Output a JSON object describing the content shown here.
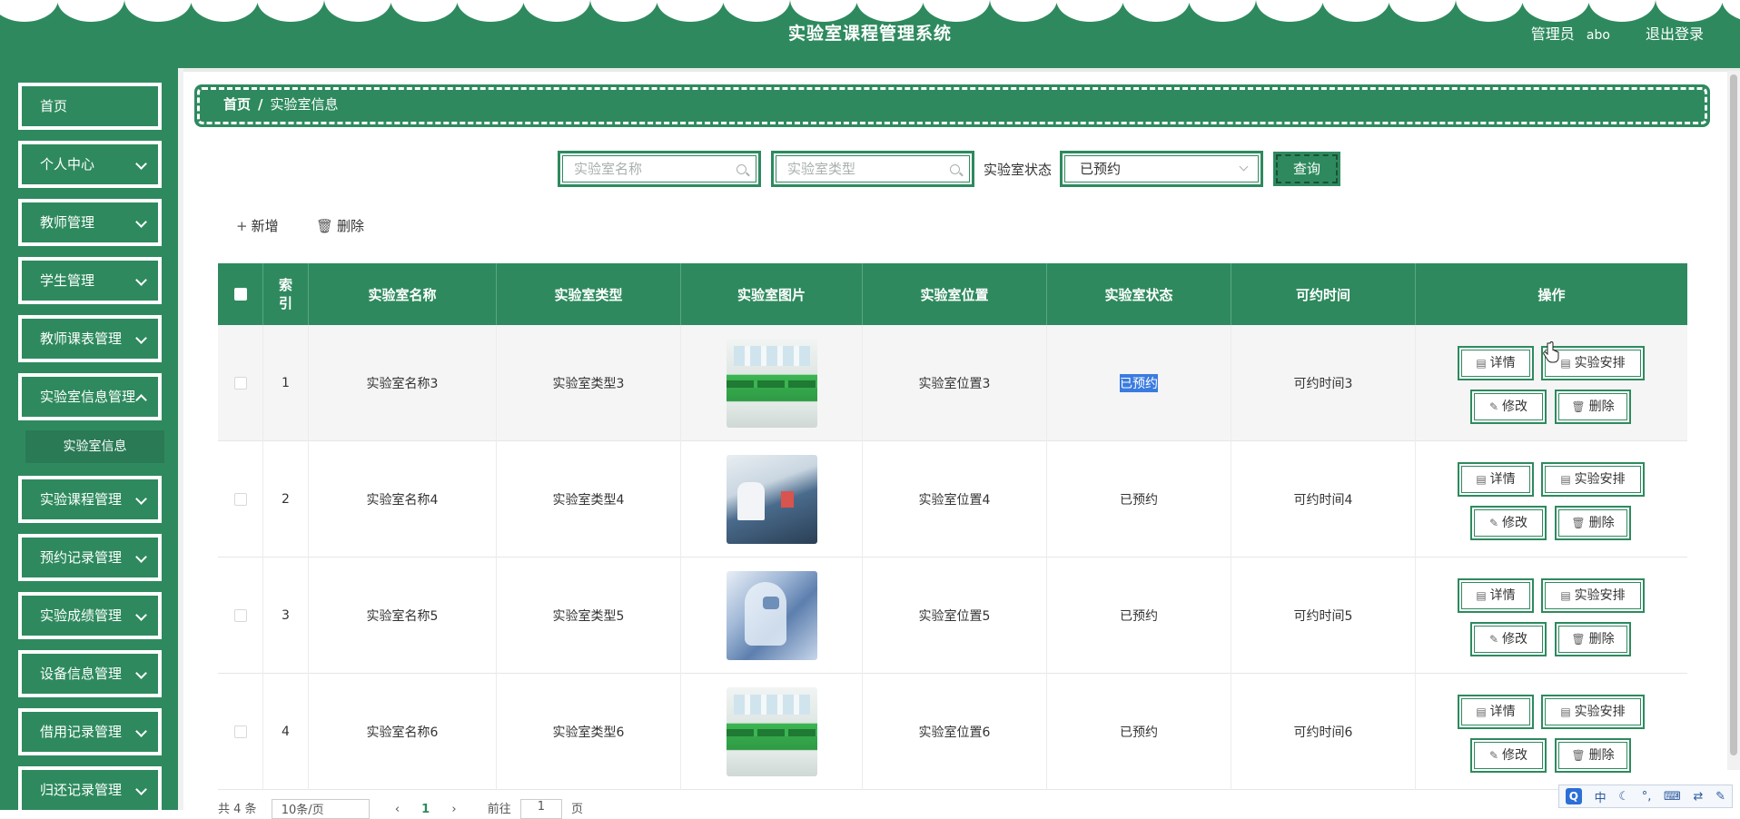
{
  "header": {
    "title": "实验室课程管理系统",
    "role": "管理员",
    "username": "abo",
    "logout": "退出登录"
  },
  "sidebar": {
    "items": [
      {
        "label": "首页",
        "expandable": false
      },
      {
        "label": "个人中心",
        "expandable": true
      },
      {
        "label": "教师管理",
        "expandable": true
      },
      {
        "label": "学生管理",
        "expandable": true
      },
      {
        "label": "教师课表管理",
        "expandable": true
      },
      {
        "label": "实验室信息管理",
        "expandable": true
      },
      {
        "label": "实验课程管理",
        "expandable": true
      },
      {
        "label": "预约记录管理",
        "expandable": true
      },
      {
        "label": "实验成绩管理",
        "expandable": true
      },
      {
        "label": "设备信息管理",
        "expandable": true
      },
      {
        "label": "借用记录管理",
        "expandable": true
      },
      {
        "label": "归还记录管理",
        "expandable": true
      }
    ],
    "active_submenu": "实验室信息"
  },
  "breadcrumb": {
    "home": "首页",
    "separator": "/",
    "current": "实验室信息"
  },
  "search": {
    "name_placeholder": "实验室名称",
    "type_placeholder": "实验室类型",
    "status_label": "实验室状态",
    "status_value": "已预约",
    "query_button": "查询"
  },
  "toolbar": {
    "add_label": "新增",
    "delete_label": "删除"
  },
  "table": {
    "columns": [
      "索引",
      "实验室名称",
      "实验室类型",
      "实验室图片",
      "实验室位置",
      "实验室状态",
      "可约时间",
      "操作"
    ],
    "rows": [
      {
        "index": "1",
        "name": "实验室名称3",
        "type": "实验室类型3",
        "location": "实验室位置3",
        "status": "已预约",
        "time": "可约时间3",
        "image": "lab-room-green-benches"
      },
      {
        "index": "2",
        "name": "实验室名称4",
        "type": "实验室类型4",
        "location": "实验室位置4",
        "status": "已预约",
        "time": "可约时间4",
        "image": "lab-researchers"
      },
      {
        "index": "3",
        "name": "实验室名称5",
        "type": "实验室类型5",
        "location": "实验室位置5",
        "status": "已预约",
        "time": "可约时间5",
        "image": "lab-protective-suit"
      },
      {
        "index": "4",
        "name": "实验室名称6",
        "type": "实验室类型6",
        "location": "实验室位置6",
        "status": "已预约",
        "time": "可约时间6",
        "image": "lab-room-green-benches"
      }
    ],
    "actions": {
      "detail": "详情",
      "arrange": "实验安排",
      "edit": "修改",
      "delete": "删除"
    }
  },
  "pagination": {
    "total": "共 4 条",
    "page_size": "10条/页",
    "current_page": "1",
    "goto_prefix": "前往",
    "goto_value": "1",
    "goto_suffix": "页"
  },
  "ime": {
    "mode": "中"
  },
  "colors": {
    "primary": "#2e8a5e",
    "selection": "#3a7be0"
  }
}
